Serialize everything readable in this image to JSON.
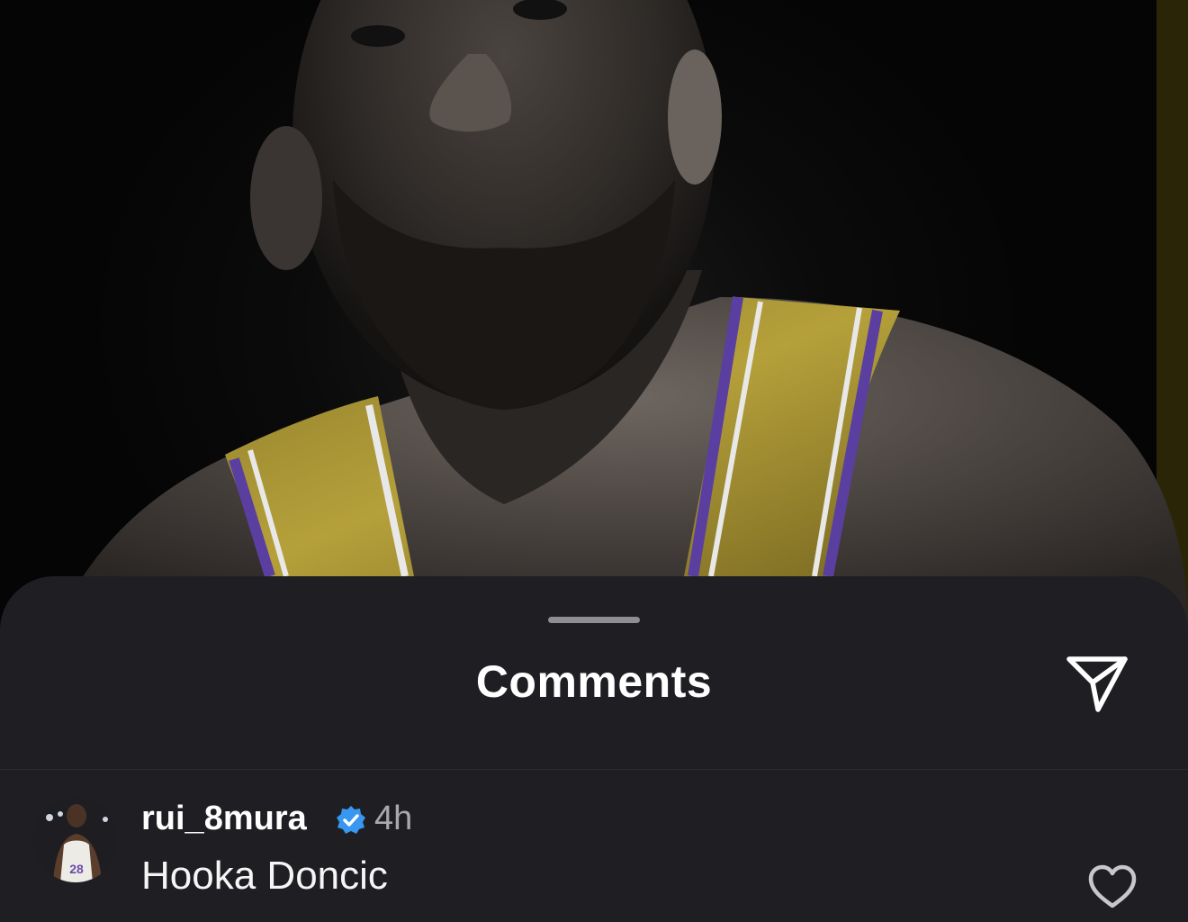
{
  "post": {
    "image_subject": "player-portrait"
  },
  "sheet": {
    "title": "Comments",
    "share_icon": "send-icon"
  },
  "comments": [
    {
      "username": "rui_8mura",
      "verified": true,
      "time": "4h",
      "text": "Hooka Doncic",
      "avatar_icon": "avatar-image",
      "like_icon": "heart-icon"
    }
  ],
  "colors": {
    "sheet_bg": "#1f1f23",
    "verified_blue": "#3897f0",
    "muted_text": "#a8a8ad"
  }
}
